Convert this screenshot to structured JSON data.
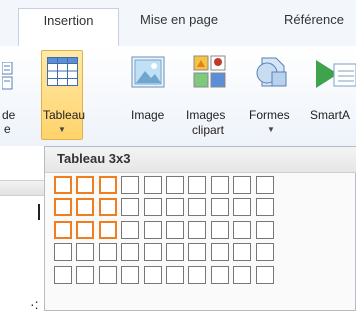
{
  "tabs": {
    "insertion": "Insertion",
    "mise_en_page": "Mise en page",
    "references": "Référence"
  },
  "ribbon": {
    "partial_left_top": "de",
    "partial_left_bottom": "e",
    "tableau": "Tableau",
    "image": "Image",
    "images_clipart_line1": "Images",
    "images_clipart_line2": "clipart",
    "formes": "Formes",
    "smartart": "SmartA"
  },
  "dropdown": {
    "title": "Tableau 3x3",
    "rows": 5,
    "cols": 10,
    "selected_rows": 3,
    "selected_cols": 3
  },
  "colors": {
    "highlight": "#ffd36b",
    "selection": "#f07d1e"
  }
}
